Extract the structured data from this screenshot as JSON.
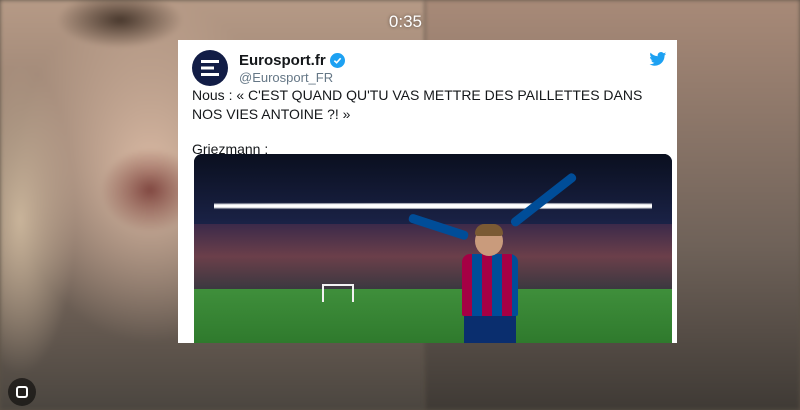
{
  "video": {
    "timer": "0:35"
  },
  "tweet": {
    "account_name": "Eurosport.fr",
    "handle": "@Eurosport_FR",
    "text_line1": "Nous : « C'EST QUAND QU'TU VAS METTRE DES PAILLETTES DANS NOS VIES ANTOINE ?! »",
    "text_line2": "Griezmann :",
    "icons": {
      "avatar": "eurosport-logo-icon",
      "verified": "verified-badge-icon",
      "brand": "twitter-bird-icon",
      "corner": "instagram-icon"
    }
  },
  "colors": {
    "twitter_blue": "#1da1f2",
    "eurosport_navy": "#121d46",
    "barca_red": "#a50044",
    "barca_blue": "#004d98"
  }
}
